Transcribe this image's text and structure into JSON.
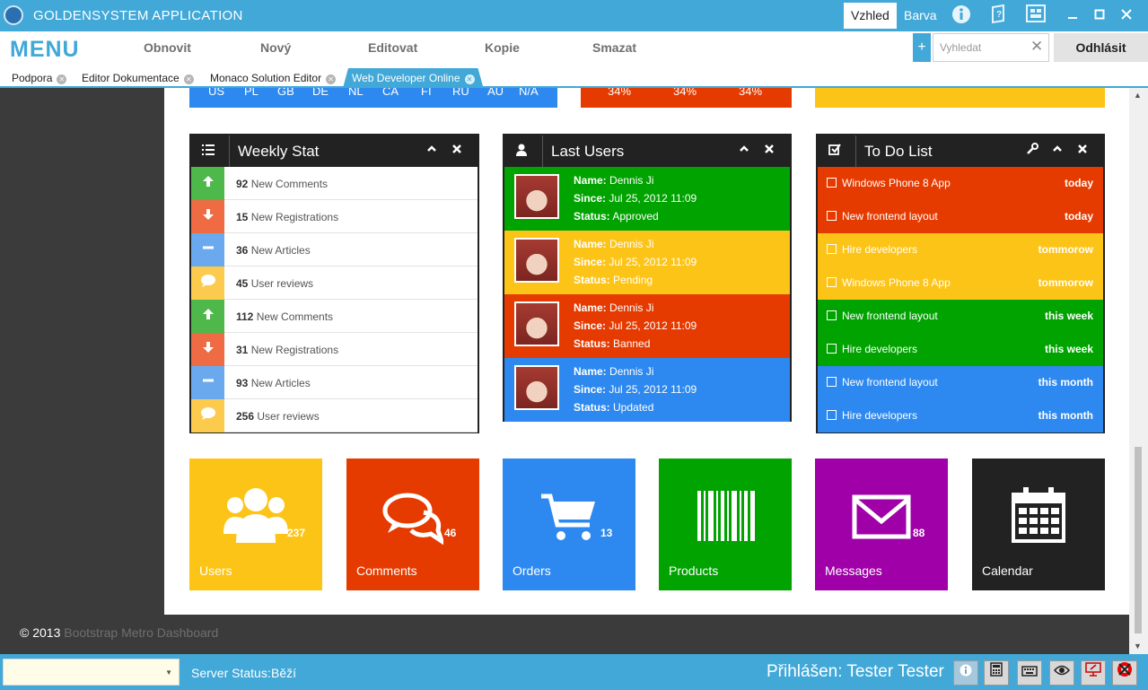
{
  "window": {
    "title": "GOLDENSYSTEM APPLICATION",
    "menus": [
      "Vzhled",
      "Barva"
    ],
    "icons": [
      "info-icon",
      "help-book-icon",
      "layout-icon"
    ],
    "controls": [
      "minimize-icon",
      "maximize-icon",
      "close-icon"
    ]
  },
  "menubar": {
    "menu_label": "MENU",
    "items": [
      "Obnovit",
      "Nový",
      "Editovat",
      "Kopie",
      "Smazat"
    ],
    "search_placeholder": "Vyhledat",
    "logout_label": "Odhlásit"
  },
  "tabs": [
    {
      "label": "Podpora",
      "active": false
    },
    {
      "label": "Editor Dokumentace",
      "active": false
    },
    {
      "label": "Monaco Solution Editor",
      "active": false
    },
    {
      "label": "Web Developer Online",
      "active": true
    }
  ],
  "top_strips": {
    "countries": [
      "US",
      "PL",
      "GB",
      "DE",
      "NL",
      "CA",
      "FI",
      "RU",
      "AU",
      "N/A"
    ],
    "percents": [
      "34%",
      "34%",
      "34%"
    ]
  },
  "weekly_stat": {
    "title": "Weekly Stat",
    "rows": [
      {
        "count": "92",
        "label": "New Comments",
        "color": "#4fb84a",
        "icon": "arrow-up-icon"
      },
      {
        "count": "15",
        "label": "New Registrations",
        "color": "#ee6b44",
        "icon": "arrow-down-icon"
      },
      {
        "count": "36",
        "label": "New Articles",
        "color": "#6aa9ee",
        "icon": "minus-icon"
      },
      {
        "count": "45",
        "label": "User reviews",
        "color": "#fccb4d",
        "icon": "comment-icon"
      },
      {
        "count": "112",
        "label": "New Comments",
        "color": "#4fb84a",
        "icon": "arrow-up-icon"
      },
      {
        "count": "31",
        "label": "New Registrations",
        "color": "#ee6b44",
        "icon": "arrow-down-icon"
      },
      {
        "count": "93",
        "label": "New Articles",
        "color": "#6aa9ee",
        "icon": "minus-icon"
      },
      {
        "count": "256",
        "label": "User reviews",
        "color": "#fccb4d",
        "icon": "comment-icon"
      }
    ]
  },
  "last_users": {
    "title": "Last Users",
    "name_label": "Name:",
    "since_label": "Since:",
    "status_label": "Status:",
    "users": [
      {
        "name": "Dennis Ji",
        "since": "Jul 25, 2012 11:09",
        "status": "Approved",
        "color": "#00a300"
      },
      {
        "name": "Dennis Ji",
        "since": "Jul 25, 2012 11:09",
        "status": "Pending",
        "color": "#fdc418"
      },
      {
        "name": "Dennis Ji",
        "since": "Jul 25, 2012 11:09",
        "status": "Banned",
        "color": "#e63b00"
      },
      {
        "name": "Dennis Ji",
        "since": "Jul 25, 2012 11:09",
        "status": "Updated",
        "color": "#2d89ef"
      }
    ]
  },
  "todo": {
    "title": "To Do List",
    "items": [
      {
        "task": "Windows Phone 8 App",
        "when": "today",
        "color": "#e63b00"
      },
      {
        "task": "New frontend layout",
        "when": "today",
        "color": "#e63b00"
      },
      {
        "task": "Hire developers",
        "when": "tommorow",
        "color": "#fdc418"
      },
      {
        "task": "Windows Phone 8 App",
        "when": "tommorow",
        "color": "#fdc418"
      },
      {
        "task": "New frontend layout",
        "when": "this week",
        "color": "#00a300"
      },
      {
        "task": "Hire developers",
        "when": "this week",
        "color": "#00a300"
      },
      {
        "task": "New frontend layout",
        "when": "this month",
        "color": "#2d89ef"
      },
      {
        "task": "Hire developers",
        "when": "this month",
        "color": "#2d89ef"
      }
    ]
  },
  "tiles": [
    {
      "label": "Users",
      "count": "237",
      "color": "#fdc418",
      "icon": "users-icon"
    },
    {
      "label": "Comments",
      "count": "46",
      "color": "#e63b00",
      "icon": "comments-icon"
    },
    {
      "label": "Orders",
      "count": "13",
      "color": "#2d89ef",
      "icon": "cart-icon"
    },
    {
      "label": "Products",
      "count": "",
      "color": "#00a300",
      "icon": "barcode-icon"
    },
    {
      "label": "Messages",
      "count": "88",
      "color": "#9f00a7",
      "icon": "envelope-icon"
    },
    {
      "label": "Calendar",
      "count": "",
      "color": "#222222",
      "icon": "calendar-icon"
    }
  ],
  "footer": {
    "copyright": "© 2013",
    "link": "Bootstrap Metro Dashboard"
  },
  "statusbar": {
    "server_label": "Server Status:",
    "server_value": "Běží",
    "logged_user": "Přihlášen: Tester Tester",
    "buttons": [
      "info-icon",
      "calculator-icon",
      "keyboard-icon",
      "remote-eye-icon",
      "remote-desktop-icon",
      "lifebuoy-icon"
    ]
  },
  "colors": {
    "accent": "#41a8d8",
    "dark": "#222222",
    "sidebar": "#3b3b3b"
  }
}
